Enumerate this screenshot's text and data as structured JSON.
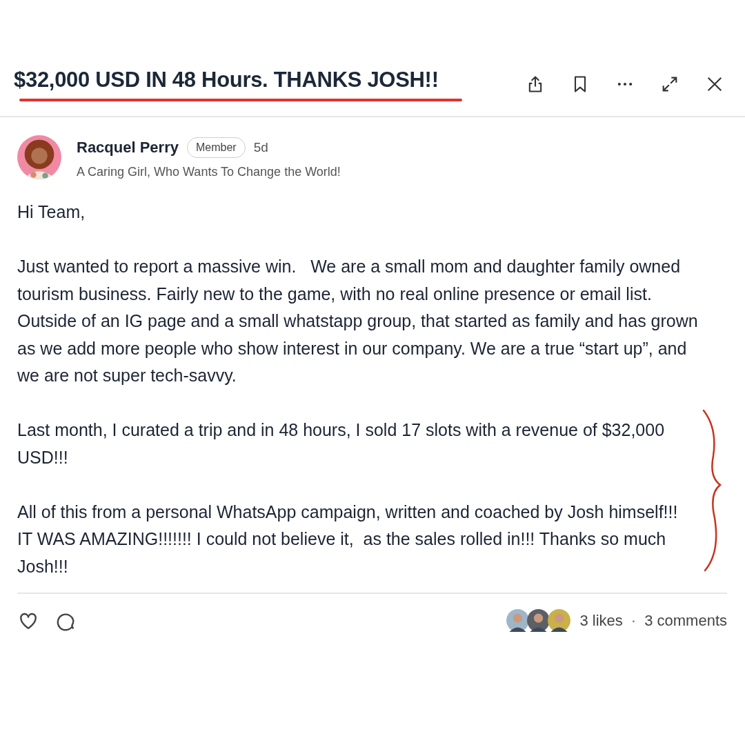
{
  "post": {
    "title": "$32,000 USD IN 48 Hours. THANKS JOSH!!",
    "author": {
      "name": "Racquel Perry",
      "badge": "Member",
      "time": "5d",
      "tagline": "A Caring Girl, Who Wants To Change the World!"
    },
    "paragraphs": [
      "Hi Team,",
      "Just wanted to report a massive win.   We are a small mom and daughter family owned tourism business. Fairly new to the game, with no real online presence or email list. Outside of an IG page and a small whatstapp group, that started as family and has grown as we add more people who show interest in our company. We are a true “start up”, and we are not super tech-savvy.",
      "Last month, I curated a trip and in 48 hours, I sold 17 slots with a revenue of $32,000 USD!!!",
      "All of this from a personal WhatsApp campaign, written and coached by Josh himself!!!  IT WAS AMAZING!!!!!!! I could not believe it,  as the sales rolled in!!! Thanks so much Josh!!!"
    ],
    "likes": "3 likes",
    "separator": "·",
    "comments": "3 comments"
  }
}
